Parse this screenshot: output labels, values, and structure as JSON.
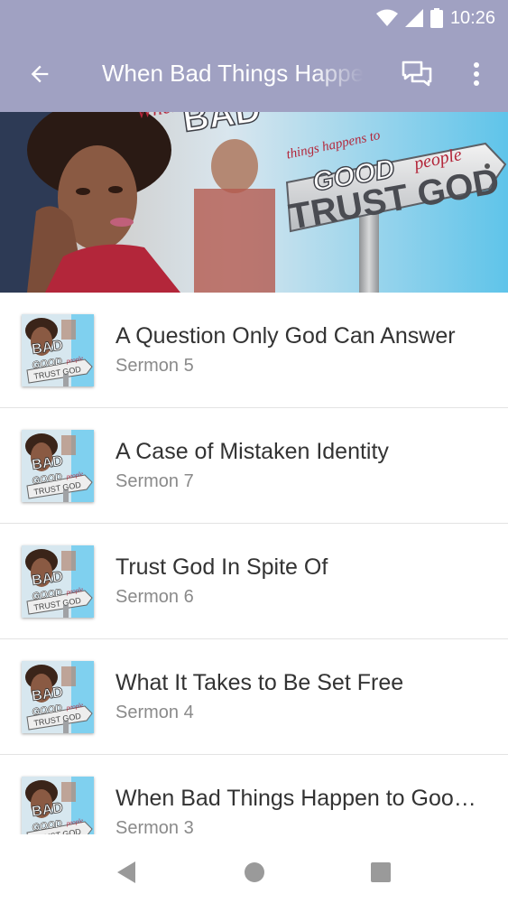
{
  "status": {
    "time": "10:26",
    "icons": [
      "wifi-icon",
      "cellular-signal-icon",
      "battery-icon"
    ]
  },
  "toolbar": {
    "title": "When Bad Things Happen to Good People",
    "icons": [
      "back-arrow-icon",
      "chat-icon",
      "more-vert-icon"
    ]
  },
  "banner": {
    "word_when": "When",
    "word_bad": "BAD",
    "word_things": "things happens to",
    "word_good": "GOOD",
    "word_people": "people",
    "word_trust": "TRUST GOD"
  },
  "thumb_text": {
    "bad": "BAD",
    "good": "GOOD",
    "people": "people",
    "trust": "TRUST GOD"
  },
  "sermons": [
    {
      "title": "A Question Only God Can Answer",
      "subtitle": "Sermon 5"
    },
    {
      "title": "A Case of Mistaken Identity",
      "subtitle": "Sermon 7"
    },
    {
      "title": "Trust God In Spite Of",
      "subtitle": "Sermon 6"
    },
    {
      "title": "What It Takes to Be Set Free",
      "subtitle": "Sermon 4"
    },
    {
      "title": "When Bad Things Happen to Good People",
      "subtitle": "Sermon 3"
    }
  ],
  "nav": {
    "icons": [
      "back-triangle-icon",
      "home-circle-icon",
      "recents-square-icon"
    ]
  },
  "colors": {
    "app_bar": "#a0a1c2",
    "title_text": "#333333",
    "subtitle_text": "#8a8a8a",
    "divider": "#e3e3e3"
  }
}
